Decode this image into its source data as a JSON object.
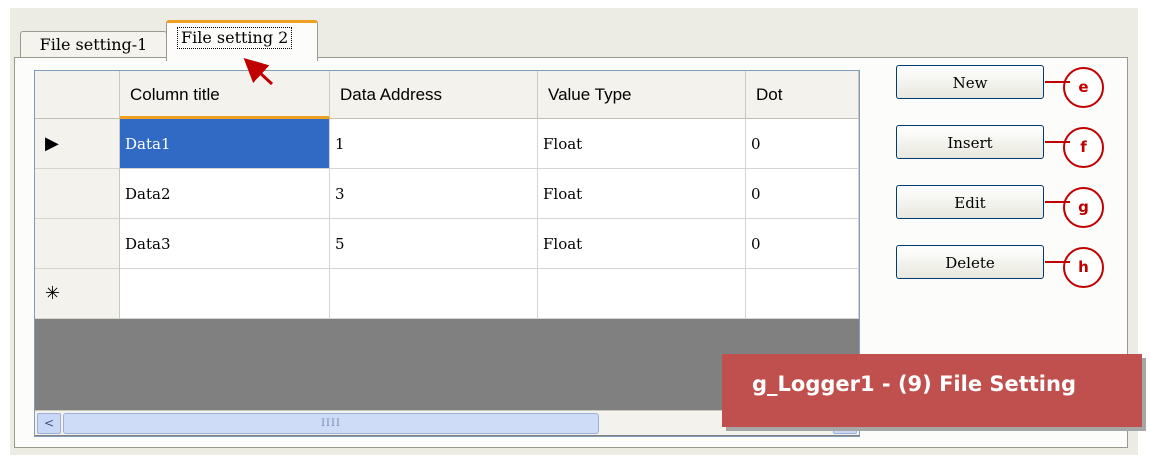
{
  "tabs": [
    {
      "label": "File setting-1"
    },
    {
      "label": "File setting 2"
    }
  ],
  "grid": {
    "columns": [
      "Column title",
      "Data Address",
      "Value Type",
      "Dot"
    ],
    "rows": [
      {
        "marker": "▶",
        "cells": [
          "Data1",
          "1",
          "Float",
          "0"
        ]
      },
      {
        "marker": "",
        "cells": [
          "Data2",
          "3",
          "Float",
          "0"
        ]
      },
      {
        "marker": "",
        "cells": [
          "Data3",
          "5",
          "Float",
          "0"
        ]
      },
      {
        "marker": "✳",
        "cells": [
          "",
          "",
          "",
          ""
        ]
      }
    ],
    "scroll_left": "<",
    "scroll_right": ">",
    "scroll_grip": "IIII"
  },
  "buttons": {
    "new": "New",
    "insert": "Insert",
    "edit": "Edit",
    "delete": "Delete"
  },
  "callouts": [
    "e",
    "f",
    "g",
    "h"
  ],
  "caption": "g_Logger1 - (9) File Setting",
  "colors": {
    "accent": "#c00000",
    "caption_bg": "#c0504d",
    "selection": "#316ac5",
    "tab_highlight": "#f0a020"
  }
}
